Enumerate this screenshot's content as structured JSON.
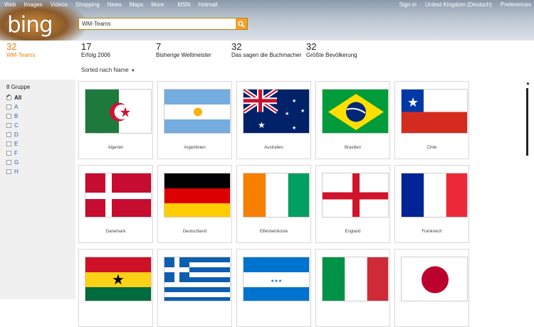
{
  "topnav": [
    "Web",
    "Images",
    "Videos",
    "Shopping",
    "News",
    "Maps",
    "More",
    "MSN",
    "Hotmail"
  ],
  "topright": [
    "Sign in",
    "United Kingdom",
    "(Deutsch)",
    "Preferences"
  ],
  "logo": "bing",
  "search": {
    "value": "WM-Teams"
  },
  "stats": [
    {
      "num": "32",
      "label": "WM-Teams"
    },
    {
      "num": "17",
      "label": "Erfolg 2006"
    },
    {
      "num": "7",
      "label": "Bisherige Weltmeister"
    },
    {
      "num": "32",
      "label": "Das sagen die Buchmacher"
    },
    {
      "num": "32",
      "label": "Größte Bevölkerung"
    }
  ],
  "sort": {
    "label": "Sorted nach Name"
  },
  "sidebar": {
    "title": "8 Gruppe",
    "items": [
      "All",
      "A",
      "B",
      "C",
      "D",
      "E",
      "F",
      "G",
      "H"
    ]
  },
  "teams": [
    {
      "name": "Algerien",
      "flag": "algeria-flag-icon"
    },
    {
      "name": "Argentinien",
      "flag": "argentina-flag-icon"
    },
    {
      "name": "Australien",
      "flag": "australia-flag-icon"
    },
    {
      "name": "Brasilien",
      "flag": "brazil-flag-icon"
    },
    {
      "name": "Chile",
      "flag": "chile-flag-icon"
    },
    {
      "name": "Danemark",
      "flag": "denmark-flag-icon"
    },
    {
      "name": "Deutschland",
      "flag": "germany-flag-icon"
    },
    {
      "name": "Elfenbeinküste",
      "flag": "ivory-coast-flag-icon"
    },
    {
      "name": "England",
      "flag": "england-flag-icon"
    },
    {
      "name": "Frankreich",
      "flag": "france-flag-icon"
    },
    {
      "name": "",
      "flag": "ghana-flag-icon"
    },
    {
      "name": "",
      "flag": "greece-flag-icon"
    },
    {
      "name": "",
      "flag": "honduras-flag-icon"
    },
    {
      "name": "",
      "flag": "italy-flag-icon"
    },
    {
      "name": "",
      "flag": "japan-flag-icon"
    }
  ],
  "colors": {
    "accent": "#e38419",
    "link": "#2860b0"
  }
}
